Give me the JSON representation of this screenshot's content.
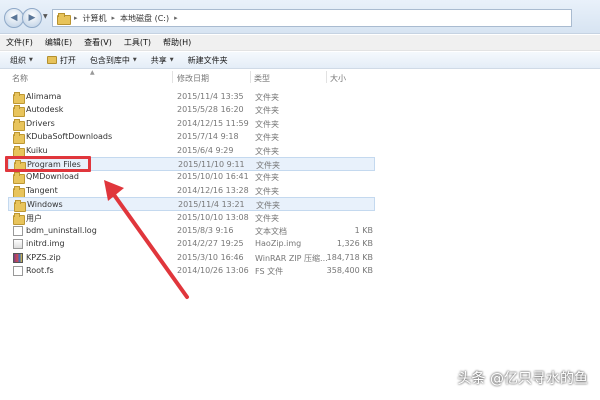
{
  "address": {
    "path": [
      "计算机",
      "本地磁盘 (C:)"
    ]
  },
  "menu": [
    "文件(F)",
    "编辑(E)",
    "查看(V)",
    "工具(T)",
    "帮助(H)"
  ],
  "toolbar": {
    "organize": "组织",
    "open": "打开",
    "include_in_library": "包含到库中",
    "share": "共享",
    "new_folder": "新建文件夹"
  },
  "columns": {
    "name": "名称",
    "date": "修改日期",
    "type": "类型",
    "size": "大小"
  },
  "files": [
    {
      "name": "Alimama",
      "date": "2015/11/4 13:35",
      "type": "文件夹",
      "size": "",
      "kind": "folder"
    },
    {
      "name": "Autodesk",
      "date": "2015/5/28 16:20",
      "type": "文件夹",
      "size": "",
      "kind": "folder"
    },
    {
      "name": "Drivers",
      "date": "2014/12/15 11:59",
      "type": "文件夹",
      "size": "",
      "kind": "folder"
    },
    {
      "name": "KDubaSoftDownloads",
      "date": "2015/7/14 9:18",
      "type": "文件夹",
      "size": "",
      "kind": "folder"
    },
    {
      "name": "Kuiku",
      "date": "2015/6/4 9:29",
      "type": "文件夹",
      "size": "",
      "kind": "folder"
    },
    {
      "name": "Program Files",
      "date": "2015/11/10 9:11",
      "type": "文件夹",
      "size": "",
      "kind": "folder"
    },
    {
      "name": "QMDownload",
      "date": "2015/10/10 16:41",
      "type": "文件夹",
      "size": "",
      "kind": "folder"
    },
    {
      "name": "Tangent",
      "date": "2014/12/16 13:28",
      "type": "文件夹",
      "size": "",
      "kind": "folder"
    },
    {
      "name": "Windows",
      "date": "2015/11/4 13:21",
      "type": "文件夹",
      "size": "",
      "kind": "folder"
    },
    {
      "name": "用户",
      "date": "2015/10/10 13:08",
      "type": "文件夹",
      "size": "",
      "kind": "folder"
    },
    {
      "name": "bdm_uninstall.log",
      "date": "2015/8/3 9:16",
      "type": "文本文档",
      "size": "1 KB",
      "kind": "file"
    },
    {
      "name": "initrd.img",
      "date": "2014/2/27 19:25",
      "type": "HaoZip.img",
      "size": "1,326 KB",
      "kind": "img"
    },
    {
      "name": "KPZS.zip",
      "date": "2015/3/10 16:46",
      "type": "WinRAR ZIP 压缩...",
      "size": "184,718 KB",
      "kind": "zip"
    },
    {
      "name": "Root.fs",
      "date": "2014/10/26 13:06",
      "type": "FS 文件",
      "size": "358,400 KB",
      "kind": "file"
    }
  ],
  "watermark": "头条 @亿只寻水的鱼"
}
